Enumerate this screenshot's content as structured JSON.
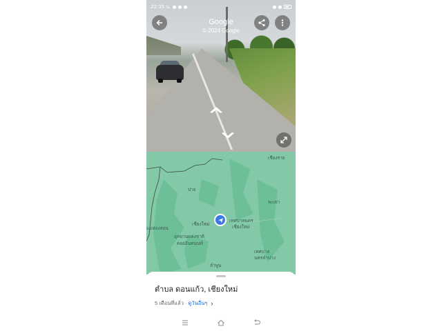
{
  "status_bar": {
    "time": "22:35 น.",
    "battery_icon": "battery-icon"
  },
  "street_view": {
    "title": "Google",
    "copyright": "© 2024 Google",
    "buttons": {
      "back": "back-arrow-icon",
      "share": "share-icon",
      "more": "more-vert-icon",
      "expand": "expand-icon"
    }
  },
  "map": {
    "labels": {
      "chiang_rai": "เชียงราย",
      "phayao": "พะเยา",
      "pai": "ปาย",
      "chiang_mai_left": "เชียงใหม่",
      "city_muni": "เทศบาลนคร",
      "city_muni2": "เชียงใหม่",
      "park1": "อุทยานแห่งชาติ",
      "park2": "ดอยอินทนนท์",
      "mae_hong_son": "แม่ฮ่องสอน",
      "lamphun": "ลำพูน",
      "lampang1": "เทศบาล",
      "lampang2": "นครลำปาง"
    },
    "colors": {
      "land": "#83c9a8",
      "forest": "#6cbf97"
    }
  },
  "sheet": {
    "place_name": "ตำบล ดอนแก้ว, เชียงใหม่",
    "date": "5 เดือนที่แล้ว · ",
    "see_more": "ดูวันอื่นๆ",
    "chevron": "›"
  },
  "nav": {
    "menu": "menu-icon",
    "home": "home-icon",
    "back": "back-icon"
  }
}
